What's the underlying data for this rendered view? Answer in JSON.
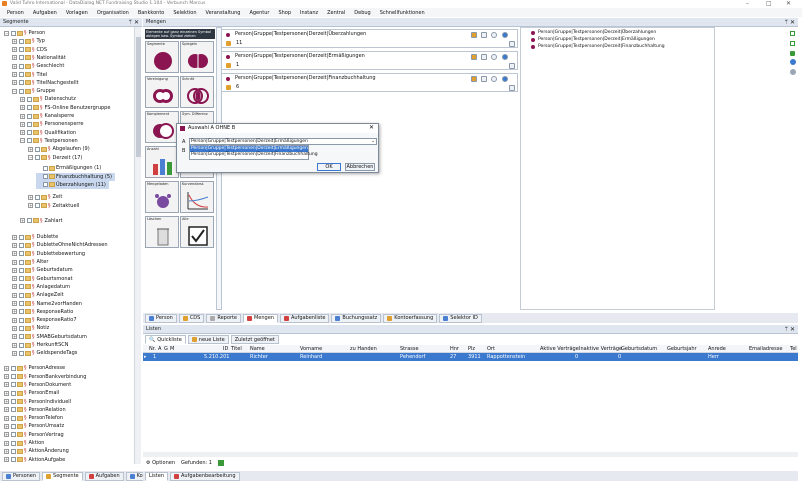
{
  "window": {
    "title": "Valid Tuhro International - DataDialog NET Fundraising Studio 1.104 - Verbunch Marcus",
    "controls": [
      "–",
      "□",
      "✕"
    ]
  },
  "menu": [
    "Person",
    "Aufgaben",
    "Vorlagen",
    "Organisation",
    "Bankkonto",
    "Selektion",
    "Veranstaltung",
    "Agentur",
    "Shop",
    "Instanz",
    "Zentral",
    "Debug",
    "Schnellfunktionen"
  ],
  "left_pane": {
    "title": "Segmente",
    "pin": "ᛘ ✕"
  },
  "tree": [
    {
      "label": "Person",
      "lvl": 0,
      "exp": "−",
      "i": 0
    },
    {
      "label": "Typ",
      "lvl": 1,
      "exp": "+",
      "i": 1
    },
    {
      "label": "CDS",
      "lvl": 1,
      "exp": "+",
      "i": 2
    },
    {
      "label": "Nationalität",
      "lvl": 1,
      "exp": "+",
      "i": 3
    },
    {
      "label": "Geschlecht",
      "lvl": 1,
      "exp": "+",
      "i": 4
    },
    {
      "label": "Titel",
      "lvl": 1,
      "exp": "+",
      "i": 5
    },
    {
      "label": "TitelNachgestellt",
      "lvl": 1,
      "exp": "+",
      "i": 6
    },
    {
      "label": "Gruppe",
      "lvl": 1,
      "exp": "−",
      "i": 7
    },
    {
      "label": "Datenschutz",
      "lvl": 2,
      "exp": "+",
      "i": 8
    },
    {
      "label": "FS-Online Benutzergruppe",
      "lvl": 2,
      "exp": "+",
      "i": 9
    },
    {
      "label": "Kanalsperre",
      "lvl": 2,
      "exp": "+",
      "i": 10
    },
    {
      "label": "Personensperre",
      "lvl": 2,
      "exp": "+",
      "i": 11
    },
    {
      "label": "Qualifikation",
      "lvl": 2,
      "exp": "+",
      "i": 12
    },
    {
      "label": "Testpersonen",
      "lvl": 2,
      "exp": "−",
      "i": 13
    },
    {
      "label": "Abgelaufen (9)",
      "lvl": 3,
      "exp": "+",
      "i": 14
    },
    {
      "label": "Derzeit (17)",
      "lvl": 3,
      "exp": "−",
      "i": 15
    },
    {
      "label": "Ermäßigungen (1)",
      "lvl": 4,
      "exp": "",
      "i": 16.3
    },
    {
      "label": "Finanzbuchhaltung (5)",
      "lvl": 4,
      "exp": "",
      "i": 17.3,
      "sel": true
    },
    {
      "label": "Überzahlungen (11)",
      "lvl": 4,
      "exp": "",
      "i": 18.3,
      "sel": true
    },
    {
      "label": "Zeit",
      "lvl": 3,
      "exp": "+",
      "i": 19.8
    },
    {
      "label": "Zeitaktuell",
      "lvl": 3,
      "exp": "+",
      "i": 20.8
    },
    {
      "label": "Zahlart",
      "lvl": 2,
      "exp": "+",
      "i": 22.6
    },
    {
      "label": "Dublette",
      "lvl": 1,
      "exp": "+",
      "i": 24.6
    },
    {
      "label": "DubletteOhneNichtAdressen",
      "lvl": 1,
      "exp": "+",
      "i": 25.6
    },
    {
      "label": "Dublettebewertung",
      "lvl": 1,
      "exp": "+",
      "i": 26.6
    },
    {
      "label": "Alter",
      "lvl": 1,
      "exp": "+",
      "i": 27.6
    },
    {
      "label": "Geburtsdatum",
      "lvl": 1,
      "exp": "+",
      "i": 28.6
    },
    {
      "label": "Geburtsmonat",
      "lvl": 1,
      "exp": "+",
      "i": 29.6
    },
    {
      "label": "Anlagedatum",
      "lvl": 1,
      "exp": "+",
      "i": 30.6
    },
    {
      "label": "AnlageZeit",
      "lvl": 1,
      "exp": "+",
      "i": 31.6
    },
    {
      "label": "Name2vorHanden",
      "lvl": 1,
      "exp": "+",
      "i": 32.6
    },
    {
      "label": "ResponseRatio",
      "lvl": 1,
      "exp": "+",
      "i": 33.6
    },
    {
      "label": "ResponseRatio7",
      "lvl": 1,
      "exp": "+",
      "i": 34.6
    },
    {
      "label": "Notiz",
      "lvl": 1,
      "exp": "+",
      "i": 35.6
    },
    {
      "label": "SMABGeburtsdatum",
      "lvl": 1,
      "exp": "+",
      "i": 36.6
    },
    {
      "label": "HerkunftSCN",
      "lvl": 1,
      "exp": "+",
      "i": 37.6
    },
    {
      "label": "GeldspendeTags",
      "lvl": 1,
      "exp": "+",
      "i": 38.6
    },
    {
      "label": "PersonAdresse",
      "lvl": 0,
      "exp": "+",
      "i": 40.4
    },
    {
      "label": "PersonBankverbindung",
      "lvl": 0,
      "exp": "+",
      "i": 41.4
    },
    {
      "label": "PersonDokument",
      "lvl": 0,
      "exp": "+",
      "i": 42.4
    },
    {
      "label": "PersonEmail",
      "lvl": 0,
      "exp": "+",
      "i": 43.4
    },
    {
      "label": "PersonIndividuell",
      "lvl": 0,
      "exp": "+",
      "i": 44.4
    },
    {
      "label": "PersonRelation",
      "lvl": 0,
      "exp": "+",
      "i": 45.4
    },
    {
      "label": "PersonTelefon",
      "lvl": 0,
      "exp": "+",
      "i": 46.4
    },
    {
      "label": "PersonUmsatz",
      "lvl": 0,
      "exp": "+",
      "i": 47.4
    },
    {
      "label": "PersonVertrag",
      "lvl": 0,
      "exp": "+",
      "i": 48.4
    },
    {
      "label": "Aktion",
      "lvl": 0,
      "exp": "+",
      "i": 49.4
    },
    {
      "label": "AktionÄnderung",
      "lvl": 0,
      "exp": "+",
      "i": 50.4
    },
    {
      "label": "AktionAufgabe",
      "lvl": 0,
      "exp": "+",
      "i": 51.4
    }
  ],
  "left_tabs": [
    "Personen",
    "Segmente",
    "Aufgaben",
    "Kontoauz."
  ],
  "mengen": {
    "title": "Mengen",
    "pin": "ᛘ ✕",
    "hint": "Elemente auf ganz einzelnen Symbol ablegen bzw. Symbol ziehen",
    "tools": [
      "Segmente",
      "Spiegeln",
      "Vereinigung",
      "Schnitt",
      "Komplement",
      "Sym. Differenz",
      "Anzahl",
      "",
      "Mengeladen",
      "Kurvendarst.",
      "Löschen",
      "Alle"
    ],
    "queries": [
      {
        "title": "Person|Gruppe|Testpersonen|Derzeit|Überzahlungen",
        "n": "11"
      },
      {
        "title": "Person|Gruppe|Testpersonen|Derzeit|Ermäßigungen",
        "n": "1"
      },
      {
        "title": "Person|Gruppe|Testpersonen|Derzeit|Finanzbuchhaltung",
        "n": "6"
      }
    ],
    "right_list": [
      "Person|Gruppe|Testpersonen|Derzeit|Überzahlungen",
      "Person|Gruppe|Testpersonen|Derzeit|Ermäßigungen",
      "Person|Gruppe|Testpersonen|Derzeit|Finanzbuchhaltung"
    ]
  },
  "dialog": {
    "title": "Auswahl A OHNE B",
    "label_a": "A",
    "label_b": "B",
    "value_a": "Person|Gruppe|Testpersonen|Derzeit|Ermäßigungen",
    "options": [
      "Person|Gruppe|Testpersonen|Derzeit|Ermäßigungen",
      "Person|Gruppe|Testpersonen|Derzeit|Finanzbuchhaltung"
    ],
    "ok": "OK",
    "cancel": "Abbrechen",
    "close": "✕"
  },
  "mid_tabs": [
    "Person",
    "CDS",
    "Reporte",
    "Mengen",
    "Aufgabenliste",
    "Buchungssatz",
    "Kontoerfassung",
    "Selektor ID"
  ],
  "listen": {
    "title": "Listen",
    "pin": "ᛘ ✕",
    "subtabs": [
      "Quickliste",
      "neue Liste",
      "Zuletzt geöffnet"
    ],
    "columns": [
      "Nr.",
      "A",
      "G",
      "M",
      "ID",
      "Titel",
      "Name",
      "Vorname",
      "zu Handen",
      "Strasse",
      "Hnr",
      "Plz",
      "Ort",
      "Aktive Verträge",
      "Inaktive Verträge",
      "Geburtsdatum",
      "Geburtsjahr",
      "Anrede",
      "Emailadresse",
      "Tel"
    ],
    "row": {
      "nr": "1",
      "id": "5.210.201",
      "name": "Richter",
      "vorname": "Reinhard",
      "strasse": "Pehendorf",
      "hnr": "27",
      "plz": "3911",
      "ort": "Rappottenstein",
      "aktive": "0",
      "inaktive": "0",
      "anrede": "Herr"
    },
    "footer": {
      "options": "Optionen",
      "gefunden": "Gefunden: 1"
    }
  },
  "bottom_tabs": [
    "Listen",
    "Aufgabenbearbeitung"
  ],
  "colors": {
    "accent": "#3b79cf",
    "venn": "#8a1550",
    "title_orange": "#e8801f"
  }
}
